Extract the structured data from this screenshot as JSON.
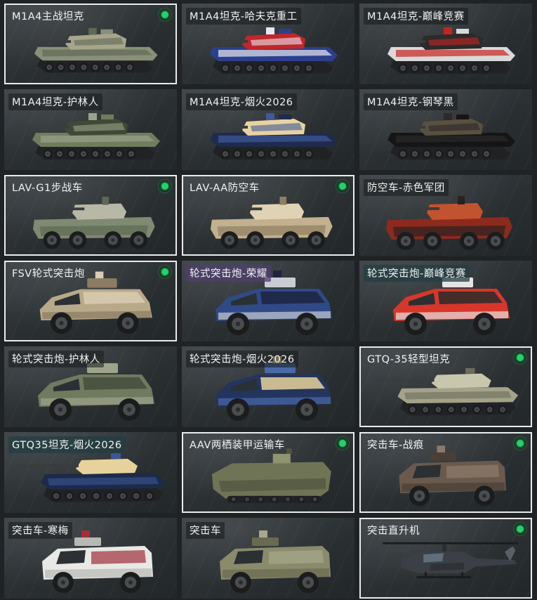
{
  "vehicles": [
    {
      "label": "M1A4主战坦克",
      "owned": true,
      "kind": "tank",
      "colors": [
        "#8a8f7a",
        "#5f6a52",
        "#a8a58c"
      ]
    },
    {
      "label": "M1A4坦克-哈夫克重工",
      "owned": false,
      "kind": "tank",
      "colors": [
        "#2c3f8e",
        "#e8e8f0",
        "#c0262b"
      ]
    },
    {
      "label": "M1A4坦克-巅峰竞赛",
      "owned": false,
      "kind": "tank",
      "colors": [
        "#d9d9d9",
        "#c8231f",
        "#2b2b2b"
      ]
    },
    {
      "label": "M1A4坦克-护林人",
      "owned": false,
      "kind": "tank",
      "colors": [
        "#6f7d5e",
        "#9aa38a",
        "#3f4a36"
      ]
    },
    {
      "label": "M1A4坦克-烟火2026",
      "owned": false,
      "kind": "tank",
      "colors": [
        "#1f2b4d",
        "#3d5a9a",
        "#e8d3a0"
      ]
    },
    {
      "label": "M1A4坦克-钢琴黑",
      "owned": false,
      "kind": "tank",
      "colors": [
        "#151515",
        "#2a2a2a",
        "#5a5040"
      ]
    },
    {
      "label": "LAV-G1步战车",
      "owned": true,
      "kind": "apc",
      "colors": [
        "#7f8a72",
        "#5e6953",
        "#b7b9a6"
      ]
    },
    {
      "label": "LAV-AA防空车",
      "owned": true,
      "kind": "apc",
      "colors": [
        "#c2b08e",
        "#8f7f62",
        "#e0d3b5"
      ]
    },
    {
      "label": "防空车-赤色军团",
      "owned": false,
      "kind": "apc",
      "colors": [
        "#8c2a1e",
        "#2a2220",
        "#c2532f"
      ]
    },
    {
      "label": "FSV轮式突击炮",
      "owned": true,
      "kind": "car",
      "colors": [
        "#b8a98a",
        "#8a7b62",
        "#d8cdb2"
      ]
    },
    {
      "label": "轮式突击炮-荣耀",
      "owned": false,
      "kind": "car",
      "colors": [
        "#2f4a86",
        "#c9ccd3",
        "#1c2540"
      ]
    },
    {
      "label": "轮式突击炮-巅峰竞赛",
      "owned": false,
      "kind": "car",
      "colors": [
        "#d8362a",
        "#e4e4e4",
        "#2a2a2a"
      ]
    },
    {
      "label": "轮式突击炮-护林人",
      "owned": false,
      "kind": "car",
      "colors": [
        "#6f7a5f",
        "#9ea48b",
        "#444d3b"
      ]
    },
    {
      "label": "轮式突击炮-烟火2026",
      "owned": false,
      "kind": "car",
      "colors": [
        "#23345e",
        "#4a69a8",
        "#e6d29a"
      ]
    },
    {
      "label": "GTQ-35轻型坦克",
      "owned": true,
      "kind": "lighttank",
      "colors": [
        "#a5a28a",
        "#6d6c5b",
        "#c9c6ae"
      ]
    },
    {
      "label": "GTQ35坦克-烟火2026",
      "owned": false,
      "kind": "lighttank",
      "colors": [
        "#1d2a4a",
        "#3b5696",
        "#e8d29c"
      ]
    },
    {
      "label": "AAV两栖装甲运输车",
      "owned": true,
      "kind": "aav",
      "colors": [
        "#6f7456",
        "#505440",
        "#8f9470"
      ]
    },
    {
      "label": "突击车-战痕",
      "owned": true,
      "kind": "mrap",
      "colors": [
        "#6a5a4e",
        "#4a3e36",
        "#8e7a6a"
      ]
    },
    {
      "label": "突击车-寒梅",
      "owned": false,
      "kind": "mrap",
      "colors": [
        "#e8e8e6",
        "#b8b8b4",
        "#a0303a"
      ]
    },
    {
      "label": "突击车",
      "owned": false,
      "kind": "mrap",
      "colors": [
        "#8a8a6c",
        "#6a6a50",
        "#a8a88a"
      ]
    },
    {
      "label": "突击直升机",
      "owned": true,
      "kind": "heli",
      "colors": [
        "#3c4046",
        "#5a5f66",
        "#2a2d31"
      ]
    }
  ]
}
